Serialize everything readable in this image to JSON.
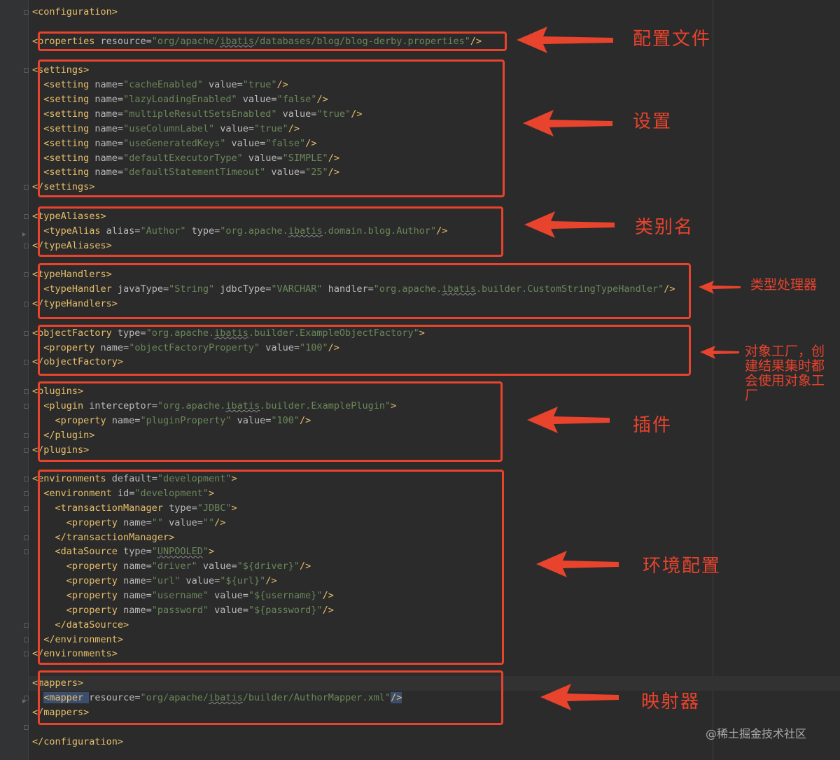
{
  "code_lines": [
    [
      [
        "t",
        "<configuration>"
      ]
    ],
    [],
    [
      [
        "t",
        "<properties "
      ],
      [
        "a",
        "resource="
      ],
      [
        "v",
        "\"org/apache/"
      ],
      [
        "v~",
        "ibatis"
      ],
      [
        "v",
        "/databases/blog/blog-derby.properties\""
      ],
      [
        "t",
        "/>"
      ]
    ],
    [],
    [
      [
        "t",
        "<settings>"
      ]
    ],
    [
      [
        "p",
        "  "
      ],
      [
        "t",
        "<setting "
      ],
      [
        "a",
        "name="
      ],
      [
        "v",
        "\"cacheEnabled\""
      ],
      [
        "a",
        " value="
      ],
      [
        "v",
        "\"true\""
      ],
      [
        "t",
        "/>"
      ]
    ],
    [
      [
        "p",
        "  "
      ],
      [
        "t",
        "<setting "
      ],
      [
        "a",
        "name="
      ],
      [
        "v",
        "\"lazyLoadingEnabled\""
      ],
      [
        "a",
        " value="
      ],
      [
        "v",
        "\"false\""
      ],
      [
        "t",
        "/>"
      ]
    ],
    [
      [
        "p",
        "  "
      ],
      [
        "t",
        "<setting "
      ],
      [
        "a",
        "name="
      ],
      [
        "v",
        "\"multipleResultSetsEnabled\""
      ],
      [
        "a",
        " value="
      ],
      [
        "v",
        "\"true\""
      ],
      [
        "t",
        "/>"
      ]
    ],
    [
      [
        "p",
        "  "
      ],
      [
        "t",
        "<setting "
      ],
      [
        "a",
        "name="
      ],
      [
        "v",
        "\"useColumnLabel\""
      ],
      [
        "a",
        " value="
      ],
      [
        "v",
        "\"true\""
      ],
      [
        "t",
        "/>"
      ]
    ],
    [
      [
        "p",
        "  "
      ],
      [
        "t",
        "<setting "
      ],
      [
        "a",
        "name="
      ],
      [
        "v",
        "\"useGeneratedKeys\""
      ],
      [
        "a",
        " value="
      ],
      [
        "v",
        "\"false\""
      ],
      [
        "t",
        "/>"
      ]
    ],
    [
      [
        "p",
        "  "
      ],
      [
        "t",
        "<setting "
      ],
      [
        "a",
        "name="
      ],
      [
        "v",
        "\"defaultExecutorType\""
      ],
      [
        "a",
        " value="
      ],
      [
        "v",
        "\"SIMPLE\""
      ],
      [
        "t",
        "/>"
      ]
    ],
    [
      [
        "p",
        "  "
      ],
      [
        "t",
        "<setting "
      ],
      [
        "a",
        "name="
      ],
      [
        "v",
        "\"defaultStatementTimeout\""
      ],
      [
        "a",
        " value="
      ],
      [
        "v",
        "\"25\""
      ],
      [
        "t",
        "/>"
      ]
    ],
    [
      [
        "t",
        "</settings>"
      ]
    ],
    [],
    [
      [
        "t",
        "<typeAliases>"
      ]
    ],
    [
      [
        "p",
        "  "
      ],
      [
        "t",
        "<typeAlias "
      ],
      [
        "a",
        "alias="
      ],
      [
        "v",
        "\"Author\""
      ],
      [
        "a",
        " type="
      ],
      [
        "v",
        "\"org.apache."
      ],
      [
        "v~",
        "ibatis"
      ],
      [
        "v",
        ".domain.blog.Author\""
      ],
      [
        "t",
        "/>"
      ]
    ],
    [
      [
        "t",
        "</typeAliases>"
      ]
    ],
    [],
    [
      [
        "t",
        "<typeHandlers>"
      ]
    ],
    [
      [
        "p",
        "  "
      ],
      [
        "t",
        "<typeHandler "
      ],
      [
        "a",
        "javaType="
      ],
      [
        "v",
        "\"String\""
      ],
      [
        "a",
        " jdbcType="
      ],
      [
        "v",
        "\"VARCHAR\""
      ],
      [
        "a",
        " handler="
      ],
      [
        "v",
        "\"org.apache."
      ],
      [
        "v~",
        "ibatis"
      ],
      [
        "v",
        ".builder.CustomStringTypeHandler\""
      ],
      [
        "t",
        "/>"
      ]
    ],
    [
      [
        "t",
        "</typeHandlers>"
      ]
    ],
    [],
    [
      [
        "t",
        "<objectFactory "
      ],
      [
        "a",
        "type="
      ],
      [
        "v",
        "\"org.apache."
      ],
      [
        "v~",
        "ibatis"
      ],
      [
        "v",
        ".builder.ExampleObjectFactory\""
      ],
      [
        "t",
        ">"
      ]
    ],
    [
      [
        "p",
        "  "
      ],
      [
        "t",
        "<property "
      ],
      [
        "a",
        "name="
      ],
      [
        "v",
        "\"objectFactoryProperty\""
      ],
      [
        "a",
        " value="
      ],
      [
        "v",
        "\"100\""
      ],
      [
        "t",
        "/>"
      ]
    ],
    [
      [
        "t",
        "</objectFactory>"
      ]
    ],
    [],
    [
      [
        "t",
        "<plugins>"
      ]
    ],
    [
      [
        "p",
        "  "
      ],
      [
        "t",
        "<plugin "
      ],
      [
        "a",
        "interceptor="
      ],
      [
        "v",
        "\"org.apache."
      ],
      [
        "v~",
        "ibatis"
      ],
      [
        "v",
        ".builder.ExamplePlugin\""
      ],
      [
        "t",
        ">"
      ]
    ],
    [
      [
        "p",
        "    "
      ],
      [
        "t",
        "<property "
      ],
      [
        "a",
        "name="
      ],
      [
        "v",
        "\"pluginProperty\""
      ],
      [
        "a",
        " value="
      ],
      [
        "v",
        "\"100\""
      ],
      [
        "t",
        "/>"
      ]
    ],
    [
      [
        "p",
        "  "
      ],
      [
        "t",
        "</plugin>"
      ]
    ],
    [
      [
        "t",
        "</plugins>"
      ]
    ],
    [],
    [
      [
        "t",
        "<environments "
      ],
      [
        "a",
        "default="
      ],
      [
        "v",
        "\"development\""
      ],
      [
        "t",
        ">"
      ]
    ],
    [
      [
        "p",
        "  "
      ],
      [
        "t",
        "<environment "
      ],
      [
        "a",
        "id="
      ],
      [
        "v",
        "\"development\""
      ],
      [
        "t",
        ">"
      ]
    ],
    [
      [
        "p",
        "    "
      ],
      [
        "t",
        "<transactionManager "
      ],
      [
        "a",
        "type="
      ],
      [
        "v",
        "\"JDBC\""
      ],
      [
        "t",
        ">"
      ]
    ],
    [
      [
        "p",
        "      "
      ],
      [
        "t",
        "<property "
      ],
      [
        "a",
        "name="
      ],
      [
        "v",
        "\"\""
      ],
      [
        "a",
        " value="
      ],
      [
        "v",
        "\"\""
      ],
      [
        "t",
        "/>"
      ]
    ],
    [
      [
        "p",
        "    "
      ],
      [
        "t",
        "</transactionManager>"
      ]
    ],
    [
      [
        "p",
        "    "
      ],
      [
        "t",
        "<dataSource "
      ],
      [
        "a",
        "type="
      ],
      [
        "v",
        "\""
      ],
      [
        "v~",
        "UNPOOLED"
      ],
      [
        "v",
        "\""
      ],
      [
        "t",
        ">"
      ]
    ],
    [
      [
        "p",
        "      "
      ],
      [
        "t",
        "<property "
      ],
      [
        "a",
        "name="
      ],
      [
        "v",
        "\"driver\""
      ],
      [
        "a",
        " value="
      ],
      [
        "v",
        "\"${driver}\""
      ],
      [
        "t",
        "/>"
      ]
    ],
    [
      [
        "p",
        "      "
      ],
      [
        "t",
        "<property "
      ],
      [
        "a",
        "name="
      ],
      [
        "v",
        "\"url\""
      ],
      [
        "a",
        " value="
      ],
      [
        "v",
        "\"${url}\""
      ],
      [
        "t",
        "/>"
      ]
    ],
    [
      [
        "p",
        "      "
      ],
      [
        "t",
        "<property "
      ],
      [
        "a",
        "name="
      ],
      [
        "v",
        "\"username\""
      ],
      [
        "a",
        " value="
      ],
      [
        "v",
        "\"${username}\""
      ],
      [
        "t",
        "/>"
      ]
    ],
    [
      [
        "p",
        "      "
      ],
      [
        "t",
        "<property "
      ],
      [
        "a",
        "name="
      ],
      [
        "v",
        "\"password\""
      ],
      [
        "a",
        " value="
      ],
      [
        "v",
        "\"${password}\""
      ],
      [
        "t",
        "/>"
      ]
    ],
    [
      [
        "p",
        "    "
      ],
      [
        "t",
        "</dataSource>"
      ]
    ],
    [
      [
        "p",
        "  "
      ],
      [
        "t",
        "</environment>"
      ]
    ],
    [
      [
        "t",
        "</environments>"
      ]
    ],
    [],
    [
      [
        "t",
        "<mappers>"
      ]
    ],
    [
      [
        "p",
        "  "
      ],
      [
        "t",
        "<mapper "
      ],
      [
        "a",
        "resource="
      ],
      [
        "v",
        "\"org/apache/"
      ],
      [
        "v~",
        "ibatis"
      ],
      [
        "v",
        "/builder/AuthorMapper.xml\""
      ],
      [
        "t",
        "/>"
      ]
    ],
    [
      [
        "t",
        "</mappers>"
      ]
    ],
    [],
    [
      [
        "t",
        "</configuration>"
      ]
    ]
  ],
  "annotations": [
    {
      "name": "annotation-properties",
      "text": "配置文件"
    },
    {
      "name": "annotation-settings",
      "text": "设置"
    },
    {
      "name": "annotation-type-aliases",
      "text": "类别名"
    },
    {
      "name": "annotation-type-handlers",
      "text": "类型处理器"
    },
    {
      "name": "annotation-object-factory",
      "text": "对象工厂，创建结果集时都会使用对象工厂"
    },
    {
      "name": "annotation-plugins",
      "text": "插件"
    },
    {
      "name": "annotation-environments",
      "text": "环境配置"
    },
    {
      "name": "annotation-mappers",
      "text": "映射器"
    }
  ],
  "watermark": "@稀土掘金技术社区",
  "colors": {
    "background": "#2b2b2b",
    "tag": "#e8bf6a",
    "attribute": "#bababa",
    "value": "#6a8759",
    "highlight": "#e8432d"
  }
}
